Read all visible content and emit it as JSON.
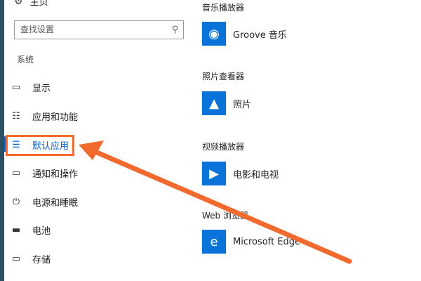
{
  "sidebar": {
    "home_label": "主页",
    "search_placeholder": "查找设置",
    "section_title": "系统",
    "items": [
      {
        "label": "显示",
        "icon": "monitor-icon"
      },
      {
        "label": "应用和功能",
        "icon": "list-icon"
      },
      {
        "label": "默认应用",
        "icon": "default-apps-icon",
        "active": true
      },
      {
        "label": "通知和操作",
        "icon": "notification-icon"
      },
      {
        "label": "电源和睡眠",
        "icon": "power-icon"
      },
      {
        "label": "电池",
        "icon": "battery-icon"
      },
      {
        "label": "存储",
        "icon": "storage-icon"
      }
    ]
  },
  "main": {
    "categories": [
      {
        "title": "音乐播放器",
        "app": "Groove 音乐",
        "icon": "groove-music-icon"
      },
      {
        "title": "照片查看器",
        "app": "照片",
        "icon": "photos-icon"
      },
      {
        "title": "视频播放器",
        "app": "电影和电视",
        "icon": "movies-tv-icon"
      },
      {
        "title": "Web 浏览器",
        "app": "Microsoft Edge",
        "icon": "edge-icon"
      }
    ]
  },
  "annotation": {
    "color": "#f26a2e"
  },
  "colors": {
    "accent": "#0a64c8",
    "tile": "#0a73d9"
  }
}
